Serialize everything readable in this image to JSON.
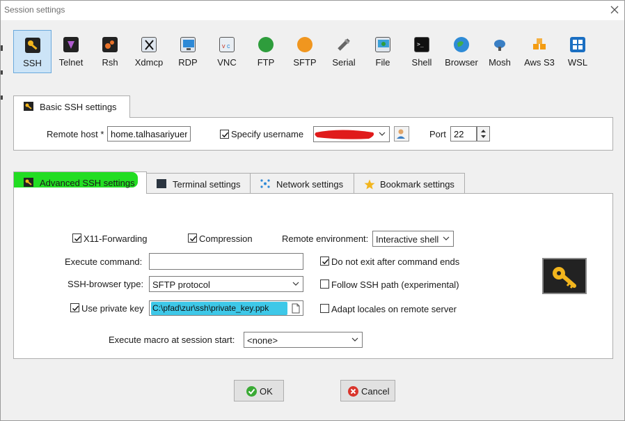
{
  "window": {
    "title": "Session settings"
  },
  "toolbar": [
    {
      "label": "SSH",
      "icon": "ssh-key-icon",
      "active": true
    },
    {
      "label": "Telnet",
      "icon": "telnet-icon"
    },
    {
      "label": "Rsh",
      "icon": "rsh-icon"
    },
    {
      "label": "Xdmcp",
      "icon": "xdmcp-icon"
    },
    {
      "label": "RDP",
      "icon": "rdp-icon"
    },
    {
      "label": "VNC",
      "icon": "vnc-icon"
    },
    {
      "label": "FTP",
      "icon": "ftp-icon"
    },
    {
      "label": "SFTP",
      "icon": "sftp-icon"
    },
    {
      "label": "Serial",
      "icon": "serial-icon"
    },
    {
      "label": "File",
      "icon": "file-icon"
    },
    {
      "label": "Shell",
      "icon": "shell-icon"
    },
    {
      "label": "Browser",
      "icon": "browser-icon"
    },
    {
      "label": "Mosh",
      "icon": "mosh-icon"
    },
    {
      "label": "Aws S3",
      "icon": "aws-s3-icon"
    },
    {
      "label": "WSL",
      "icon": "wsl-icon"
    }
  ],
  "basic": {
    "tab_label": "Basic SSH settings",
    "remote_host_label": "Remote host *",
    "remote_host_value": "home.talhasariyuere",
    "specify_username_label": "Specify username",
    "specify_username_checked": true,
    "username_value": "",
    "port_label": "Port",
    "port_value": "22"
  },
  "advanced_tabs": [
    {
      "label": "Advanced SSH settings",
      "icon": "key-icon",
      "selected": true
    },
    {
      "label": "Terminal settings",
      "icon": "terminal-icon"
    },
    {
      "label": "Network settings",
      "icon": "network-icon"
    },
    {
      "label": "Bookmark settings",
      "icon": "star-icon"
    }
  ],
  "advanced": {
    "x11_label": "X11-Forwarding",
    "x11_checked": true,
    "compression_label": "Compression",
    "compression_checked": true,
    "remote_env_label": "Remote environment:",
    "remote_env_value": "Interactive shell",
    "execute_command_label": "Execute command:",
    "execute_command_value": "",
    "do_not_exit_label": "Do not exit after command ends",
    "do_not_exit_checked": true,
    "ssh_browser_label": "SSH-browser type:",
    "ssh_browser_value": "SFTP protocol",
    "follow_ssh_path_label": "Follow SSH path (experimental)",
    "follow_ssh_path_checked": false,
    "private_key_label": "Use private key",
    "private_key_checked": true,
    "private_key_value": "C:\\pfad\\zur\\ssh\\private_key.ppk",
    "adapt_locales_label": "Adapt locales on remote server",
    "adapt_locales_checked": false,
    "macro_label": "Execute macro at session start:",
    "macro_value": "<none>"
  },
  "buttons": {
    "ok": "OK",
    "cancel": "Cancel"
  },
  "colors": {
    "toolbar_active_bg": "#cce4f7",
    "highlight_green": "#22dd22",
    "highlight_cyan": "#3ec8e8",
    "redaction_red": "#e01b1b",
    "key_yellow": "#f2b51d"
  }
}
